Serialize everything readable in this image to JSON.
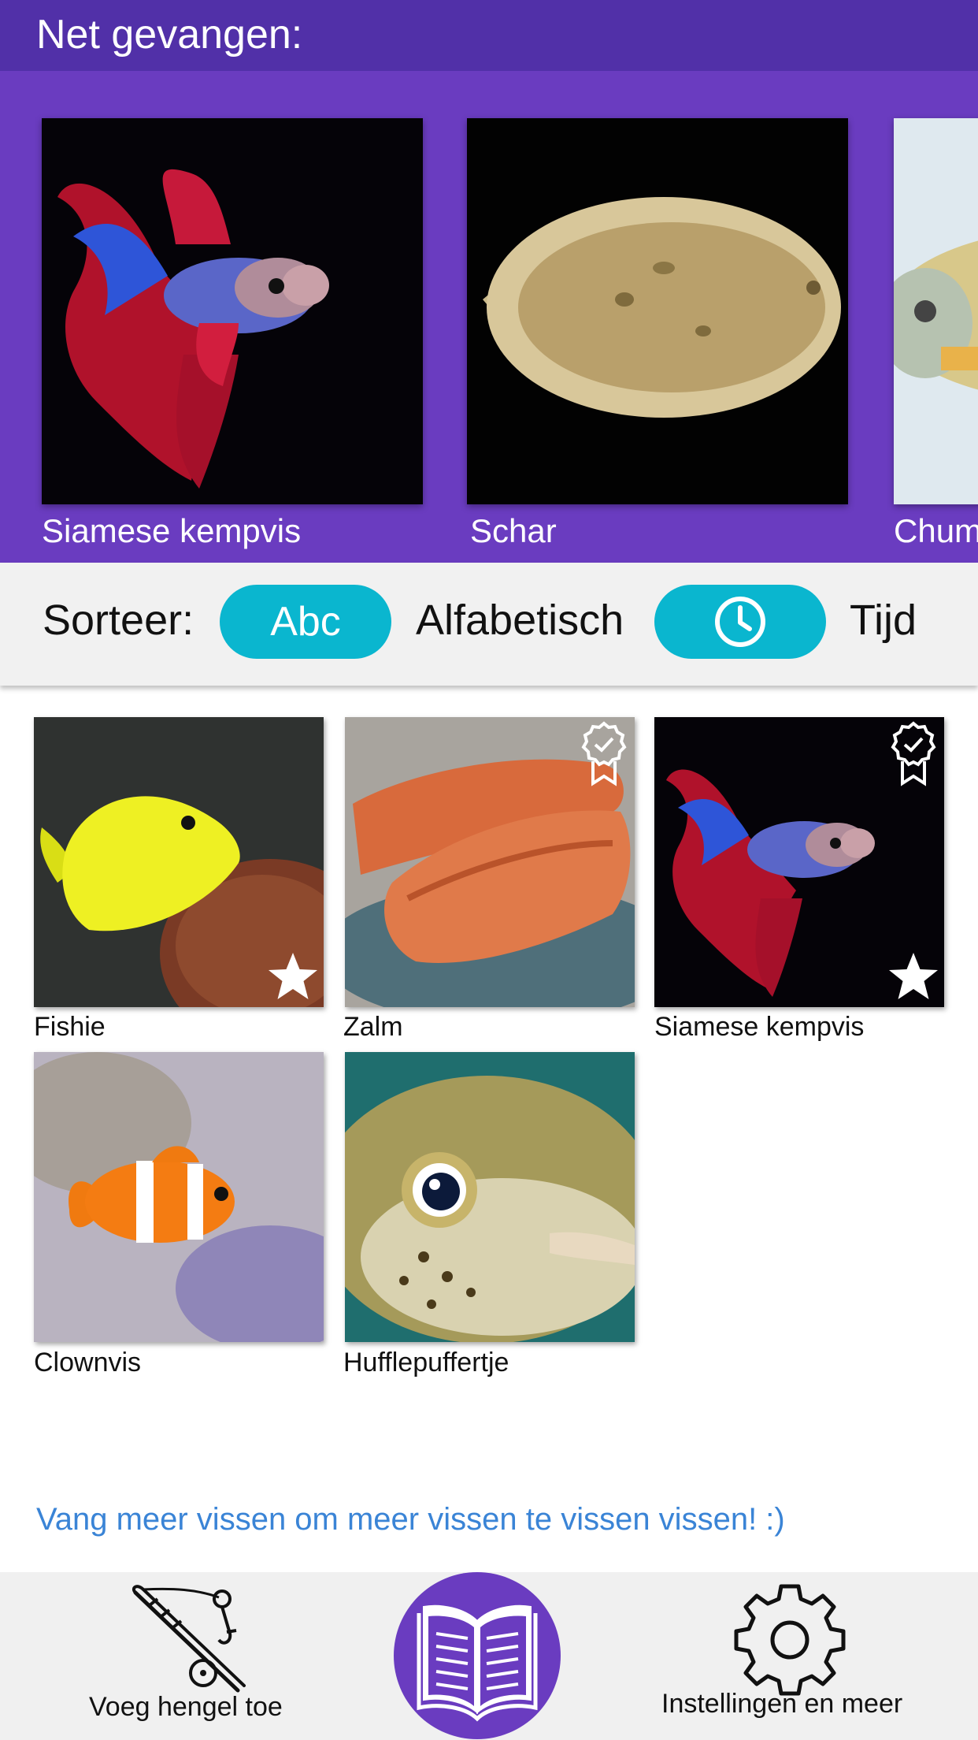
{
  "header": {
    "title": "Net gevangen:"
  },
  "recent": {
    "items": [
      {
        "name": "Siamese kempvis"
      },
      {
        "name": "Schar"
      },
      {
        "name": "Chum"
      }
    ]
  },
  "sort": {
    "label": "Sorteer:",
    "options": [
      {
        "button": "Abc",
        "label": "Alfabetisch",
        "icon": "clock-icon"
      },
      {
        "button": "",
        "label": "Tijd",
        "icon": "clock-icon"
      }
    ]
  },
  "collection": {
    "items": [
      {
        "name": "Fishie",
        "favorite": true,
        "badge": false
      },
      {
        "name": "Zalm",
        "favorite": false,
        "badge": true
      },
      {
        "name": "Siamese kempvis",
        "favorite": true,
        "badge": true
      },
      {
        "name": "Clownvis",
        "favorite": false,
        "badge": false
      },
      {
        "name": "Hufflepuffertje",
        "favorite": false,
        "badge": false
      }
    ]
  },
  "hint": "Vang meer vissen om meer vissen te vissen vissen! :)",
  "nav": {
    "add": {
      "label": "Voeg hengel toe",
      "icon": "fishing-rod-icon"
    },
    "center": {
      "icon": "open-book-icon"
    },
    "settings": {
      "label": "Instellingen en meer",
      "icon": "gear-icon"
    }
  },
  "colors": {
    "header": "#5130a8",
    "carousel": "#6a3cc0",
    "accent": "#0ab6cf",
    "link": "#3a84d6",
    "navbar": "#f0f0f0"
  }
}
